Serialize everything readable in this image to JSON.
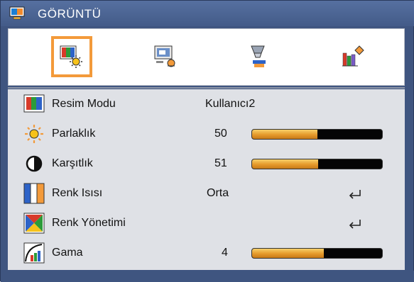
{
  "window": {
    "title": "GÖRÜNTÜ"
  },
  "tabs": [
    {
      "name": "image-settings-icon",
      "selected": true
    },
    {
      "name": "screen-icon",
      "selected": false
    },
    {
      "name": "settings-icon",
      "selected": false
    },
    {
      "name": "options-icon",
      "selected": false
    }
  ],
  "menu": [
    {
      "label": "Resim Modu",
      "value": "Kullanıcı2",
      "icon": "color-mode-icon"
    },
    {
      "label": "Parlaklık",
      "value": "50",
      "icon": "sun-icon",
      "slider_fraction": 0.5
    },
    {
      "label": "Karşıtlık",
      "value": "51",
      "icon": "contrast-icon",
      "slider_fraction": 0.51
    },
    {
      "label": "Renk Isısı",
      "value": "Orta",
      "icon": "color-temperature-icon",
      "action": "enter-icon"
    },
    {
      "label": "Renk Yönetimi",
      "value": "",
      "icon": "color-management-icon",
      "action": "enter-icon"
    },
    {
      "label": "Gama",
      "value": "4",
      "icon": "gamma-curve-icon",
      "slider_fraction": 0.55
    }
  ],
  "colors": {
    "frame": "#3f5580",
    "selection": "#f39a3a",
    "slider_fill": "#e59a2b",
    "slider_track": "#050505"
  }
}
